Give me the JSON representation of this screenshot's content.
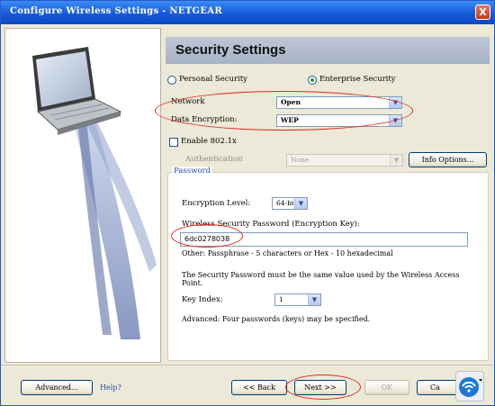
{
  "window": {
    "title": "Configure Wireless Settings - NETGEAR",
    "close_glyph": "X"
  },
  "section_title": "Security Settings",
  "security_modes": [
    {
      "label": "Personal Security",
      "selected": false
    },
    {
      "label": "Enterprise Security",
      "selected": true
    }
  ],
  "network": {
    "label": "Network",
    "value": "Open"
  },
  "data_encryption": {
    "label": "Data Encryption:",
    "value": "WEP"
  },
  "enable_8021x": {
    "label": "Enable 802.1x",
    "checked": false
  },
  "authentication": {
    "label": "Authentication",
    "value": "None",
    "button": "Info Options..."
  },
  "password_group": {
    "legend": "Password",
    "encryption_level": {
      "label": "Encryption Level:",
      "value": "64-bit"
    },
    "key_label": "Wireless Security Password (Encryption Key):",
    "key_value": "6dc0278038",
    "hint": "Other: Passphrase - 5 characters or Hex - 10 hexadecimal",
    "note": "The Security Password must be the same value used by the Wireless Access Point.",
    "key_index": {
      "label": "Key Index:",
      "value": "1"
    },
    "advanced_note": "Advanced: Four passwords (keys) may be specified."
  },
  "footer": {
    "advanced_button": "Advanced...",
    "help_link": "Help?",
    "back_button": "<< Back",
    "next_button": "Next >>",
    "ok_button": "OK",
    "cancel_button": "Ca"
  },
  "colors": {
    "annotation": "#e02a1a",
    "titlebar": "#1659d8",
    "banner": "#b0bbcc"
  },
  "icons": [
    "laptop-icon",
    "wireless-icon",
    "close-icon",
    "chevron-down-icon"
  ]
}
